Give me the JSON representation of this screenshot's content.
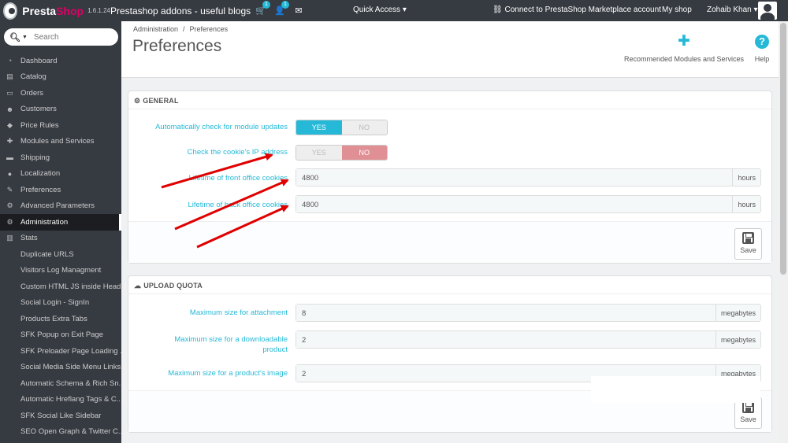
{
  "topbar": {
    "brand_a": "Presta",
    "brand_b": "Shop",
    "version": "1.6.1.24",
    "shop_name": "Prestashop addons - useful blogs",
    "cart_icon": "cart-icon",
    "cart_badge": "1",
    "customer_icon": "customer-icon",
    "customer_badge": "1",
    "mail_icon": "envelope-icon",
    "quick_access": "Quick Access",
    "connect": "Connect to PrestaShop Marketplace account",
    "my_shop": "My shop",
    "user": "Zohaib Khan"
  },
  "search": {
    "placeholder": "Search"
  },
  "sidebar": {
    "items": [
      {
        "label": "Dashboard",
        "icon": "dashboard-icon",
        "glyph": "◔"
      },
      {
        "label": "Catalog",
        "icon": "book-icon",
        "glyph": "▤"
      },
      {
        "label": "Orders",
        "icon": "credit-card-icon",
        "glyph": "▭"
      },
      {
        "label": "Customers",
        "icon": "group-icon",
        "glyph": "☻"
      },
      {
        "label": "Price Rules",
        "icon": "tags-icon",
        "glyph": "◆"
      },
      {
        "label": "Modules and Services",
        "icon": "puzzle-icon",
        "glyph": "✚"
      },
      {
        "label": "Shipping",
        "icon": "truck-icon",
        "glyph": "▬"
      },
      {
        "label": "Localization",
        "icon": "globe-icon",
        "glyph": "●"
      },
      {
        "label": "Preferences",
        "icon": "wrench-icon",
        "glyph": "✎"
      },
      {
        "label": "Advanced Parameters",
        "icon": "cogs-icon",
        "glyph": "⚙"
      },
      {
        "label": "Administration",
        "icon": "cog-icon",
        "glyph": "⚙"
      },
      {
        "label": "Stats",
        "icon": "bar-chart-icon",
        "glyph": "▥"
      },
      {
        "label": "Duplicate URLS"
      },
      {
        "label": "Visitors Log Managment"
      },
      {
        "label": "Custom HTML JS inside Head..."
      },
      {
        "label": "Social Login - SignIn"
      },
      {
        "label": "Products Extra Tabs"
      },
      {
        "label": "SFK Popup on Exit Page"
      },
      {
        "label": "SFK Preloader Page Loading ..."
      },
      {
        "label": "Social Media Side Menu Links"
      },
      {
        "label": "Automatic Schema & Rich Sn..."
      },
      {
        "label": "Automatic Hreflang Tags & C..."
      },
      {
        "label": "SFK Social Like Sidebar"
      },
      {
        "label": "SEO Open Graph & Twitter C..."
      }
    ]
  },
  "page": {
    "breadcrumb_1": "Administration",
    "breadcrumb_2": "Preferences",
    "title": "Preferences",
    "recommended": "Recommended Modules and Services",
    "help": "Help",
    "help_glyph": "?"
  },
  "general": {
    "heading": "GENERAL",
    "module_updates_label": "Automatically check for module updates",
    "module_updates_yes": "YES",
    "module_updates_no": "NO",
    "module_updates_value": "YES",
    "ip_label": "Check the cookie's IP address",
    "ip_yes": "YES",
    "ip_no": "NO",
    "ip_value": "NO",
    "front_label": "Lifetime of front office cookies",
    "front_value": "4800",
    "front_unit": "hours",
    "back_label": "Lifetime of back office cookies",
    "back_value": "4800",
    "back_unit": "hours",
    "save": "Save"
  },
  "upload": {
    "heading": "UPLOAD QUOTA",
    "attach_label": "Maximum size for attachment",
    "attach_value": "8",
    "attach_unit": "megabytes",
    "download_label": "Maximum size for a downloadable product",
    "download_value": "2",
    "download_unit": "megabytes",
    "image_label": "Maximum size for a product's image",
    "image_value": "2",
    "image_unit": "megabytes",
    "save": "Save"
  },
  "colors": {
    "accent": "#25b9d7",
    "topbar": "#363a41",
    "no_red": "#e08f95",
    "arrow": "#e00000"
  }
}
